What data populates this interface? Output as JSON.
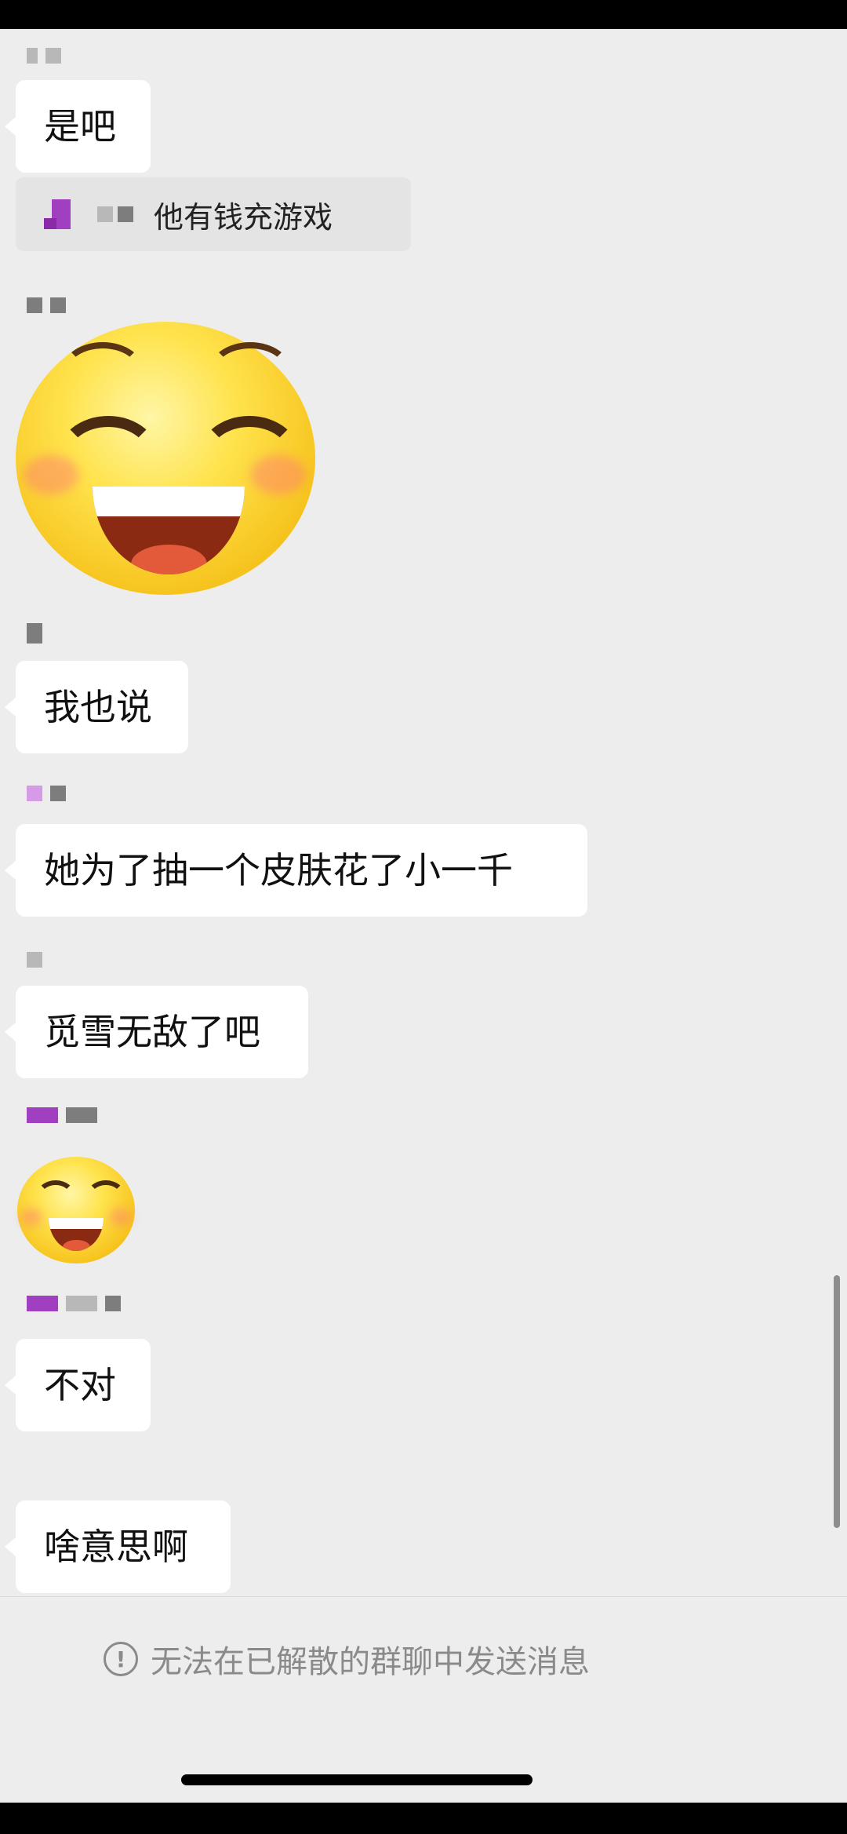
{
  "messages": [
    {
      "text": "是吧"
    },
    {
      "quote": "他有钱充游戏"
    },
    {
      "text": "我也说"
    },
    {
      "text": "她为了抽一个皮肤花了小一千"
    },
    {
      "text": "觅雪无敌了吧"
    },
    {
      "text": "不对"
    },
    {
      "text": "啥意思啊"
    }
  ],
  "footer": {
    "notice_icon": "!",
    "notice_text": "无法在已解散的群聊中发送消息"
  },
  "icons": {
    "emoji": "grinning-emoji",
    "notice": "exclamation-circle-icon"
  }
}
